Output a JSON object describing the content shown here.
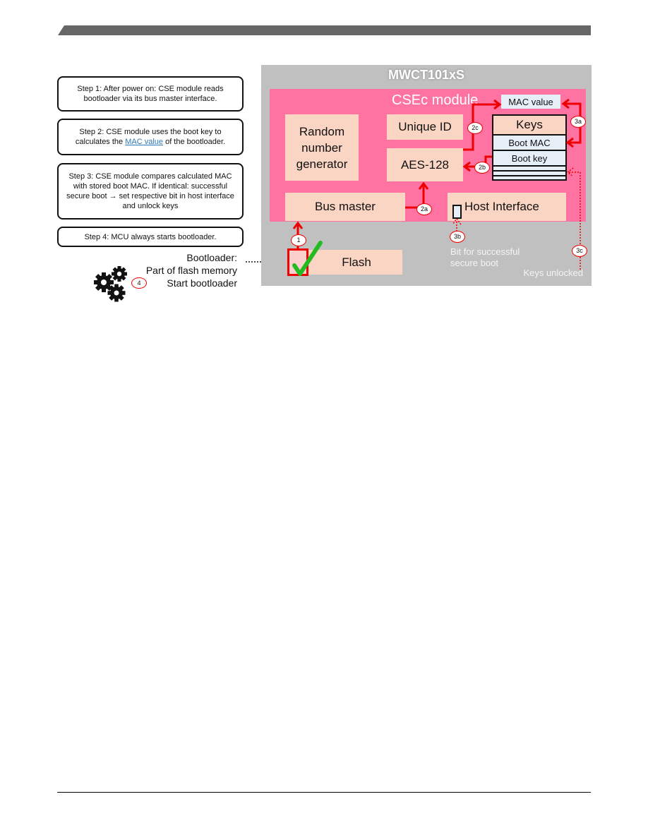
{
  "steps": [
    {
      "text_a": "Step 1: After power on: CSE module reads bootloader via its bus master interface."
    },
    {
      "text_a": "Step 2: CSE module uses the boot key to calculates the ",
      "link": "MAC value",
      "text_b": " of the bootloader."
    },
    {
      "text_a": "Step 3: CSE module compares calculated MAC with stored boot MAC. If identical: successful secure boot → set respective  bit in host interface and unlock keys"
    },
    {
      "text_a": "Step 4: MCU always starts bootloader."
    }
  ],
  "bootloader_legend": {
    "line1": "Bootloader:",
    "line2": "Part of flash memory",
    "line3": "Start bootloader",
    "step_marker": "4",
    "icon": "gears-icon"
  },
  "diagram": {
    "chip_title": "MWCT101xS",
    "module_title": "CSEc module",
    "blocks": {
      "rng": "Random number generator",
      "unique_id": "Unique  ID",
      "aes": "AES-128",
      "bus_master": "Bus master",
      "host_interface": "Host Interface",
      "mac_value": "MAC value",
      "flash": "Flash"
    },
    "keys_table": {
      "header": "Keys",
      "rows": [
        "Boot MAC",
        "Boot key"
      ]
    },
    "labels": {
      "bit_success": "Bit for successful secure boot",
      "keys_unlocked": "Keys unlocked"
    },
    "step_markers": [
      "1",
      "2a",
      "2b",
      "2c",
      "3a",
      "3b",
      "3c"
    ]
  },
  "colors": {
    "chip_bg": "#c0c0c0",
    "module_bg": "#ff73a3",
    "block_bg": "#fbd5c4",
    "accent_red": "#ee0000",
    "check_green": "#22bb22"
  }
}
